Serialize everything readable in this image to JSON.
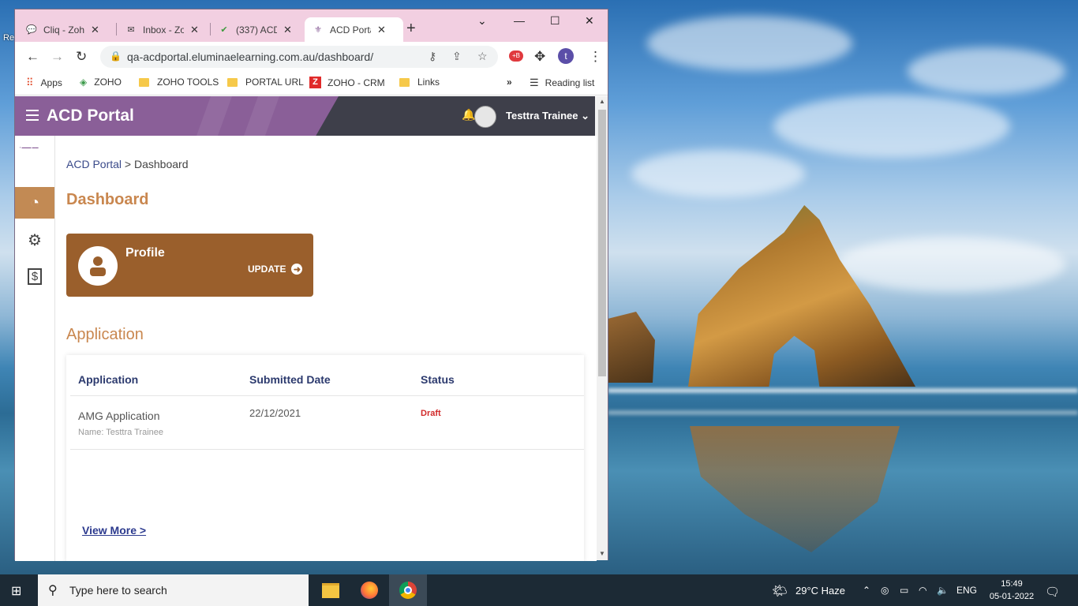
{
  "browser": {
    "tabs": [
      {
        "title": "Cliq - Zoho",
        "icon": "cliq-icon"
      },
      {
        "title": "Inbox - Zoho",
        "icon": "mail-icon"
      },
      {
        "title": "(337) ACD",
        "icon": "check-icon"
      },
      {
        "title": "ACD Portal",
        "icon": "portal-icon",
        "active": true
      }
    ],
    "new_tab": "+",
    "window_controls": [
      "⌄",
      "—",
      "☐",
      "✕"
    ],
    "url": "qa-acdportal.eluminaelearning.com.au/dashboard/",
    "profile_initial": "t",
    "bookmarks": [
      "Apps",
      "ZOHO",
      "ZOHO TOOLS",
      "PORTAL URL",
      "ZOHO - CRM",
      "Links"
    ],
    "more": "»",
    "reading_list": "Reading list"
  },
  "portal": {
    "brand": "ACD Portal",
    "user": "Testtra Trainee",
    "breadcrumb": {
      "root": "ACD Portal",
      "sep": " > ",
      "current": "Dashboard"
    },
    "dashboard_heading": "Dashboard",
    "profile_card": {
      "title": "Profile",
      "action": "UPDATE"
    },
    "application_heading": "Application",
    "table": {
      "headers": [
        "Application",
        "Submitted Date",
        "Status"
      ],
      "rows": [
        {
          "name": "AMG Application",
          "sub": "Name: Testtra Trainee",
          "date": "22/12/2021",
          "status": "Draft"
        }
      ]
    },
    "view_more": "View More >"
  },
  "taskbar": {
    "search_placeholder": "Type here to search",
    "weather": "29°C  Haze",
    "lang": "ENG",
    "time": "15:49",
    "date": "05-01-2022"
  },
  "colors": {
    "accent": "#c9874f",
    "card": "#9a5f2c",
    "header": "#8a5f98",
    "status_draft": "#d12b2b"
  }
}
